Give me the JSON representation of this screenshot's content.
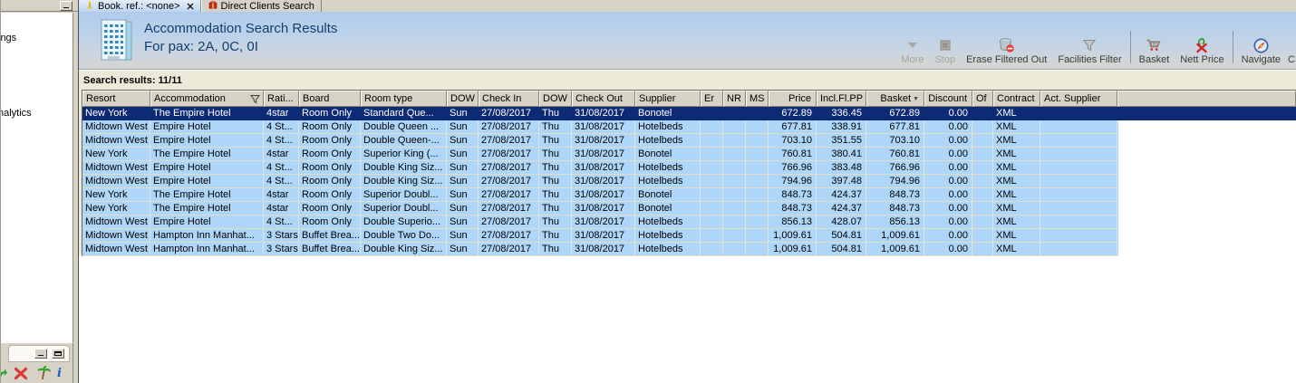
{
  "tabs": [
    {
      "label": "Book. ref.: <none>",
      "icon": "booking-tab-icon",
      "active": true,
      "closable": true
    },
    {
      "label": "Direct Clients Search",
      "icon": "clients-tab-icon",
      "active": false
    }
  ],
  "header": {
    "title": "Accommodation Search Results",
    "subtitle": "For pax: 2A, 0C, 0I",
    "icon": "building-icon"
  },
  "toolbar": {
    "buttons": [
      {
        "name": "more-button",
        "label": "More",
        "icon": "chevron-down-icon",
        "disabled": true
      },
      {
        "name": "stop-button",
        "label": "Stop",
        "icon": "stop-icon",
        "disabled": true
      },
      {
        "name": "erase-filtered-out-button",
        "label": "Erase Filtered Out",
        "icon": "erase-trash-icon",
        "disabled": false
      },
      {
        "name": "facilities-filter-button",
        "label": "Facilities Filter",
        "icon": "funnel-icon",
        "disabled": false
      },
      {
        "type": "separator"
      },
      {
        "name": "basket-button",
        "label": "Basket",
        "icon": "basket-cart-icon",
        "disabled": false
      },
      {
        "name": "nett-price-button",
        "label": "Nett Price",
        "icon": "nett-price-icon",
        "disabled": false
      },
      {
        "type": "separator"
      },
      {
        "name": "navigate-button",
        "label": "Navigate",
        "icon": "compass-icon",
        "disabled": false
      },
      {
        "name": "clipped-button",
        "label": "C",
        "icon": null,
        "disabled": false,
        "partial": true
      }
    ]
  },
  "results_bar": {
    "label": "Search results: 11/11"
  },
  "table": {
    "columns": [
      "Resort",
      "Accommodation",
      "Rati...",
      "Board",
      "Room type",
      "DOW",
      "Check In",
      "DOW",
      "Check Out",
      "Supplier",
      "Er",
      "NR",
      "MS",
      "Price",
      "Incl.Fl.PP",
      "Basket",
      "Discount",
      "Of",
      "Contract",
      "Act. Supplier"
    ],
    "filter_column_index": 1,
    "sort_column_index": 15,
    "selected_row_index": 0,
    "rows": [
      [
        "New York",
        "The Empire Hotel",
        "4star",
        "Room Only",
        "Standard Que...",
        "Sun",
        "27/08/2017",
        "Thu",
        "31/08/2017",
        "Bonotel",
        "",
        "",
        "",
        "672.89",
        "336.45",
        "672.89",
        "0.00",
        "",
        "XML",
        ""
      ],
      [
        "Midtown West",
        "Empire Hotel",
        "4 St...",
        "Room Only",
        "Double Queen ...",
        "Sun",
        "27/08/2017",
        "Thu",
        "31/08/2017",
        "Hotelbeds",
        "",
        "",
        "",
        "677.81",
        "338.91",
        "677.81",
        "0.00",
        "",
        "XML",
        ""
      ],
      [
        "Midtown West",
        "Empire Hotel",
        "4 St...",
        "Room Only",
        "Double Queen-...",
        "Sun",
        "27/08/2017",
        "Thu",
        "31/08/2017",
        "Hotelbeds",
        "",
        "",
        "",
        "703.10",
        "351.55",
        "703.10",
        "0.00",
        "",
        "XML",
        ""
      ],
      [
        "New York",
        "The Empire Hotel",
        "4star",
        "Room Only",
        "Superior King (...",
        "Sun",
        "27/08/2017",
        "Thu",
        "31/08/2017",
        "Bonotel",
        "",
        "",
        "",
        "760.81",
        "380.41",
        "760.81",
        "0.00",
        "",
        "XML",
        ""
      ],
      [
        "Midtown West",
        "Empire Hotel",
        "4 St...",
        "Room Only",
        "Double King Siz...",
        "Sun",
        "27/08/2017",
        "Thu",
        "31/08/2017",
        "Hotelbeds",
        "",
        "",
        "",
        "766.96",
        "383.48",
        "766.96",
        "0.00",
        "",
        "XML",
        ""
      ],
      [
        "Midtown West",
        "Empire Hotel",
        "4 St...",
        "Room Only",
        "Double King Siz...",
        "Sun",
        "27/08/2017",
        "Thu",
        "31/08/2017",
        "Hotelbeds",
        "",
        "",
        "",
        "794.96",
        "397.48",
        "794.96",
        "0.00",
        "",
        "XML",
        ""
      ],
      [
        "New York",
        "The Empire Hotel",
        "4star",
        "Room Only",
        "Superior Doubl...",
        "Sun",
        "27/08/2017",
        "Thu",
        "31/08/2017",
        "Bonotel",
        "",
        "",
        "",
        "848.73",
        "424.37",
        "848.73",
        "0.00",
        "",
        "XML",
        ""
      ],
      [
        "New York",
        "The Empire Hotel",
        "4star",
        "Room Only",
        "Superior Doubl...",
        "Sun",
        "27/08/2017",
        "Thu",
        "31/08/2017",
        "Bonotel",
        "",
        "",
        "",
        "848.73",
        "424.37",
        "848.73",
        "0.00",
        "",
        "XML",
        ""
      ],
      [
        "Midtown West",
        "Empire Hotel",
        "4 St...",
        "Room Only",
        "Double Superio...",
        "Sun",
        "27/08/2017",
        "Thu",
        "31/08/2017",
        "Hotelbeds",
        "",
        "",
        "",
        "856.13",
        "428.07",
        "856.13",
        "0.00",
        "",
        "XML",
        ""
      ],
      [
        "Midtown West",
        "Hampton Inn Manhat...",
        "3 Stars",
        "Buffet Brea...",
        "Double Two Do...",
        "Sun",
        "27/08/2017",
        "Thu",
        "31/08/2017",
        "Hotelbeds",
        "",
        "",
        "",
        "1,009.61",
        "504.81",
        "1,009.61",
        "0.00",
        "",
        "XML",
        ""
      ],
      [
        "Midtown West",
        "Hampton Inn Manhat...",
        "3 Stars",
        "Buffet Brea...",
        "Double King Siz...",
        "Sun",
        "27/08/2017",
        "Thu",
        "31/08/2017",
        "Hotelbeds",
        "",
        "",
        "",
        "1,009.61",
        "504.81",
        "1,009.61",
        "0.00",
        "",
        "XML",
        ""
      ]
    ]
  },
  "sidebar": {
    "items": [
      "ings",
      "nalytics"
    ],
    "bottom_icons": [
      "undo-arrow-icon",
      "red-x-icon",
      "palm-tree-icon",
      "info-icon"
    ]
  },
  "colors": {
    "selected_row_bg": "#0d2a75",
    "row_bg": "#aed6f8",
    "title_text": "#123f6e",
    "results_bar_bg": "#ece9d8",
    "chrome_bg": "#d6d2c6"
  }
}
